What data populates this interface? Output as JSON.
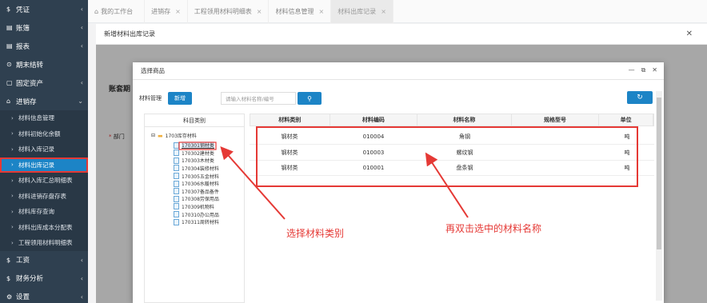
{
  "sidebar": {
    "items": [
      {
        "icon": "$",
        "label": "凭证",
        "chev": "‹"
      },
      {
        "icon": "▤",
        "label": "账簿",
        "chev": "‹"
      },
      {
        "icon": "▤",
        "label": "报表",
        "chev": "‹"
      },
      {
        "icon": "⊙",
        "label": "期末结转",
        "chev": ""
      },
      {
        "icon": "▢",
        "label": "固定资产",
        "chev": "‹"
      },
      {
        "icon": "⌂",
        "label": "进销存",
        "chev": "⌄"
      }
    ],
    "subitems": [
      "材料信息管理",
      "材料初始化余额",
      "材料入库记录",
      "材料出库记录",
      "材料入库汇总明细表",
      "材料进销存盘存表",
      "材料库存查询",
      "材料出库成本分配表",
      "工程领用材料明细表"
    ],
    "bottom": [
      {
        "icon": "$",
        "label": "工资",
        "chev": "‹"
      },
      {
        "icon": "$",
        "label": "财务分析",
        "chev": "‹"
      },
      {
        "icon": "⚙",
        "label": "设置",
        "chev": "‹"
      }
    ]
  },
  "tabs": [
    {
      "label": "我的工作台",
      "close": ""
    },
    {
      "label": "进销存",
      "close": "×"
    },
    {
      "label": "工程领用材料明细表",
      "close": "×"
    },
    {
      "label": "材料信息管理",
      "close": "×"
    },
    {
      "label": "材料出库记录",
      "close": "×"
    }
  ],
  "outer": {
    "title": "新增材料出库记录",
    "label": "账套期",
    "dept_req": "*",
    "dept_label": "部门"
  },
  "dialog": {
    "title": "选择商品",
    "toolbar_label": "材料管理",
    "new_button": "新增",
    "search_placeholder": "请输入材料名称/编号",
    "search_icon": "⚲",
    "refresh_icon": "↻",
    "tree_header": "科目类别",
    "tree_root": "1703库存材料",
    "tree_nodes": [
      "170301钢材类",
      "170302建材类",
      "170303木材类",
      "170304装修材料",
      "170305五金材料",
      "170306水暖材料",
      "170307备品备件",
      "170308劳保用品",
      "170309机物料",
      "170310办公用品",
      "170311周转材料"
    ],
    "columns": [
      "材料类别",
      "材料编码",
      "材料名称",
      "规格型号",
      "单位"
    ],
    "rows": [
      [
        "钢材类",
        "010004",
        "角钢",
        "",
        "吨"
      ],
      [
        "钢材类",
        "010003",
        "螺纹钢",
        "",
        "吨"
      ],
      [
        "钢材类",
        "010001",
        "盘条钢",
        "",
        "吨"
      ]
    ]
  },
  "annotations": {
    "select_category": "选择材料类别",
    "double_click": "再双击选中的材料名称"
  },
  "colors": {
    "sidebar_bg": "#2f4050",
    "accent": "#1c84c6",
    "annotation": "#e53935"
  }
}
